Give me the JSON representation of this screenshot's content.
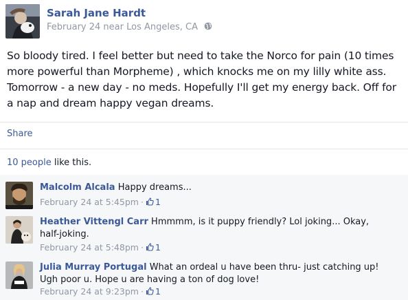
{
  "post": {
    "author": "Sarah Jane Hardt",
    "date": "February 24",
    "location_text": "near Los Angeles, CA",
    "body": "So bloody tired. I feel better but need to take the Norco for pain (10 times more powerful than Morpheme) , which knocks me on my lilly white ass. Tomorrow - a new day - no meds. Hopefully I'll get my energy back. Off for a nap and dream happy vegan dreams.",
    "privacy_icon": "globe-icon"
  },
  "actions": {
    "share_label": "Share"
  },
  "likes": {
    "people_link": "10 people",
    "suffix": " like this."
  },
  "comments": [
    {
      "author": "Malcolm Alcala",
      "text": "Happy dreams...",
      "timestamp": "February 24 at 5:45pm",
      "like_count": "1"
    },
    {
      "author": "Heather Vittengl Carr",
      "text": "Hmmmm, is it puppy friendly? Lol joking... Okay, half-joking.",
      "timestamp": "February 24 at 5:48pm",
      "like_count": "1"
    },
    {
      "author": "Julia Murray Portugal",
      "text": "What an ordeal u have been thru- just catching up! Ugh poor u. Hope u are having a ton of dog love!",
      "timestamp": "February 24 at 9:23pm",
      "like_count": "1"
    }
  ],
  "colors": {
    "link": "#3b5998",
    "meta": "#9197a3",
    "text": "#141823",
    "comments_bg": "#f6f7f8"
  }
}
